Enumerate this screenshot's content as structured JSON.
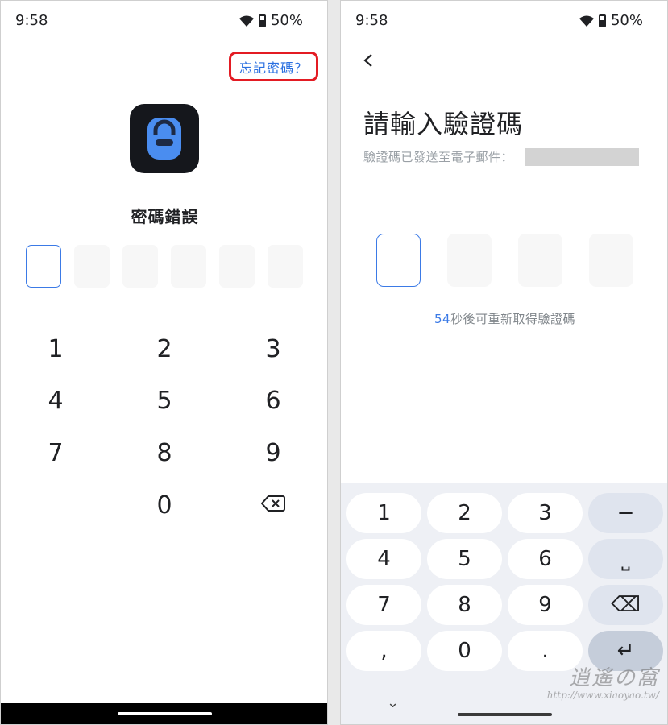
{
  "left": {
    "status": {
      "time": "9:58",
      "battery": "50%"
    },
    "forgot_label": "忘記密碼？",
    "title": "密碼錯誤",
    "pin_count": 6,
    "keys": [
      "1",
      "2",
      "3",
      "4",
      "5",
      "6",
      "7",
      "8",
      "9",
      "0"
    ],
    "backspace_icon": "backspace-icon"
  },
  "right": {
    "status": {
      "time": "9:58",
      "battery": "50%"
    },
    "title": "請輸入驗證碼",
    "subtitle": "驗證碼已發送至電子郵件：",
    "code_count": 4,
    "resend_seconds": "54",
    "resend_text": "秒後可重新取得驗證碼",
    "keyboard": {
      "row1": [
        "1",
        "2",
        "3",
        "−"
      ],
      "row2": [
        "4",
        "5",
        "6",
        "⎵"
      ],
      "row3": [
        "7",
        "8",
        "9",
        "⌫"
      ],
      "row4": [
        ",",
        "0",
        ".",
        "↵"
      ]
    },
    "watermark_line1": "逍遙の窩",
    "watermark_line2": "http://www.xiaoyao.tw/"
  },
  "colors": {
    "accent": "#2a6fe0",
    "highlight": "#e31b23",
    "active_box": "#3b7ae6"
  }
}
